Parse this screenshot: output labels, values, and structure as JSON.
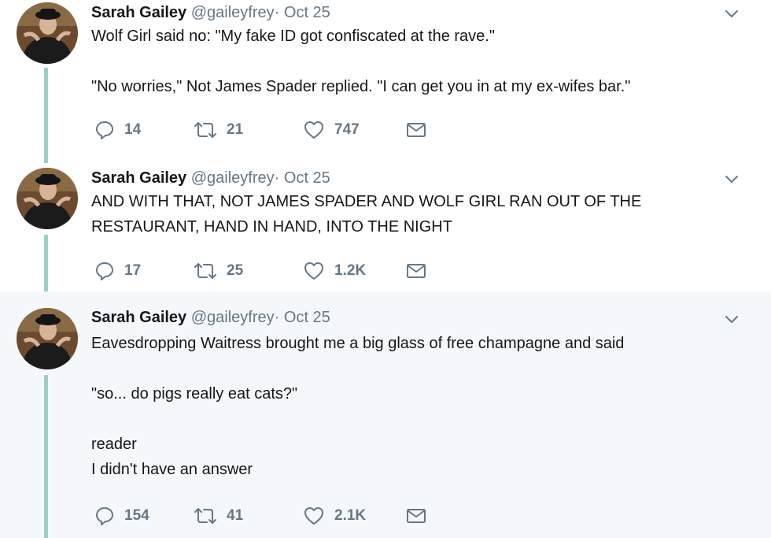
{
  "tweets": [
    {
      "name": "Sarah Gailey",
      "handle": "@gaileyfrey",
      "separator": "·",
      "time": "Oct 25",
      "lines": [
        "Wolf Girl said no: \"My fake ID got confiscated at the rave.\"",
        "",
        "\"No worries,\" Not James Spader replied. \"I can get you in at my ex-wifes bar.\""
      ],
      "replies": "14",
      "retweets": "21",
      "likes": "747"
    },
    {
      "name": "Sarah Gailey",
      "handle": "@gaileyfrey",
      "separator": "·",
      "time": "Oct 25",
      "lines": [
        "AND WITH THAT, NOT JAMES SPADER AND WOLF GIRL RAN OUT OF THE",
        "RESTAURANT, HAND IN HAND, INTO THE NIGHT"
      ],
      "replies": "17",
      "retweets": "25",
      "likes": "1.2K"
    },
    {
      "name": "Sarah Gailey",
      "handle": "@gaileyfrey",
      "separator": "·",
      "time": "Oct 25",
      "lines": [
        "Eavesdropping Waitress brought me a big glass of free champagne and said",
        "",
        "\"so... do pigs really eat cats?\"",
        "",
        "reader",
        "I didn't have an answer"
      ],
      "replies": "154",
      "retweets": "41",
      "likes": "2.1K"
    }
  ],
  "icons": {
    "reply": "reply-icon",
    "retweet": "retweet-icon",
    "like": "heart-icon",
    "dm": "envelope-icon",
    "more": "chevron-down-icon"
  },
  "colors": {
    "thread_line": "#9ccfc6",
    "icon_gray": "#657786",
    "highlight_bg": "#f5f8fa"
  }
}
